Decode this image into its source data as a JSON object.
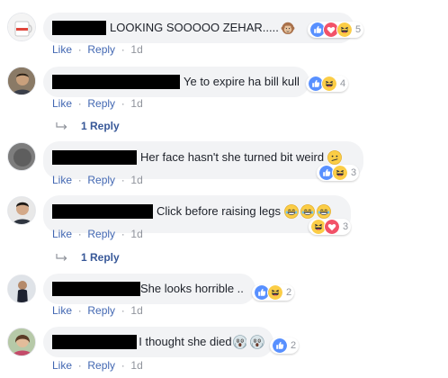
{
  "comments": [
    {
      "text": "LOOKING SOOOOO ZEHAR.....",
      "reaction_count": "5",
      "reactions": [
        "like-reaction",
        "love-reaction",
        "haha-reaction"
      ],
      "actions": {
        "like": "Like",
        "reply": "Reply",
        "time": "1d"
      }
    },
    {
      "text": "Ye to expire ha bill kull",
      "reaction_count": "4",
      "reactions": [
        "like-reaction",
        "haha-reaction"
      ],
      "actions": {
        "like": "Like",
        "reply": "Reply",
        "time": "1d"
      },
      "replies_label": "1 Reply"
    },
    {
      "text": "Her face hasn't she turned bit weird",
      "reaction_count": "3",
      "reactions": [
        "like-reaction",
        "haha-reaction"
      ],
      "actions": {
        "like": "Like",
        "reply": "Reply",
        "time": "1d"
      }
    },
    {
      "text": "Click before raising legs",
      "reaction_count": "3",
      "reactions": [
        "haha-reaction",
        "love-reaction"
      ],
      "actions": {
        "like": "Like",
        "reply": "Reply",
        "time": "1d"
      },
      "replies_label": "1 Reply"
    },
    {
      "text": "She looks horrible ..",
      "reaction_count": "2",
      "reactions": [
        "like-reaction",
        "haha-reaction"
      ],
      "actions": {
        "like": "Like",
        "reply": "Reply",
        "time": "1d"
      }
    },
    {
      "text": "I thought she died",
      "reaction_count": "2",
      "reactions": [
        "like-reaction"
      ],
      "actions": {
        "like": "Like",
        "reply": "Reply",
        "time": "1d"
      }
    }
  ],
  "separator": "·",
  "colors": {
    "link": "#4267b2",
    "meta": "#90949c",
    "bubble": "#f2f3f5",
    "text": "#1d2129",
    "like_blue": "#5890ff",
    "love_red": "#f25268",
    "haha_yellow": "#fbcd46"
  }
}
